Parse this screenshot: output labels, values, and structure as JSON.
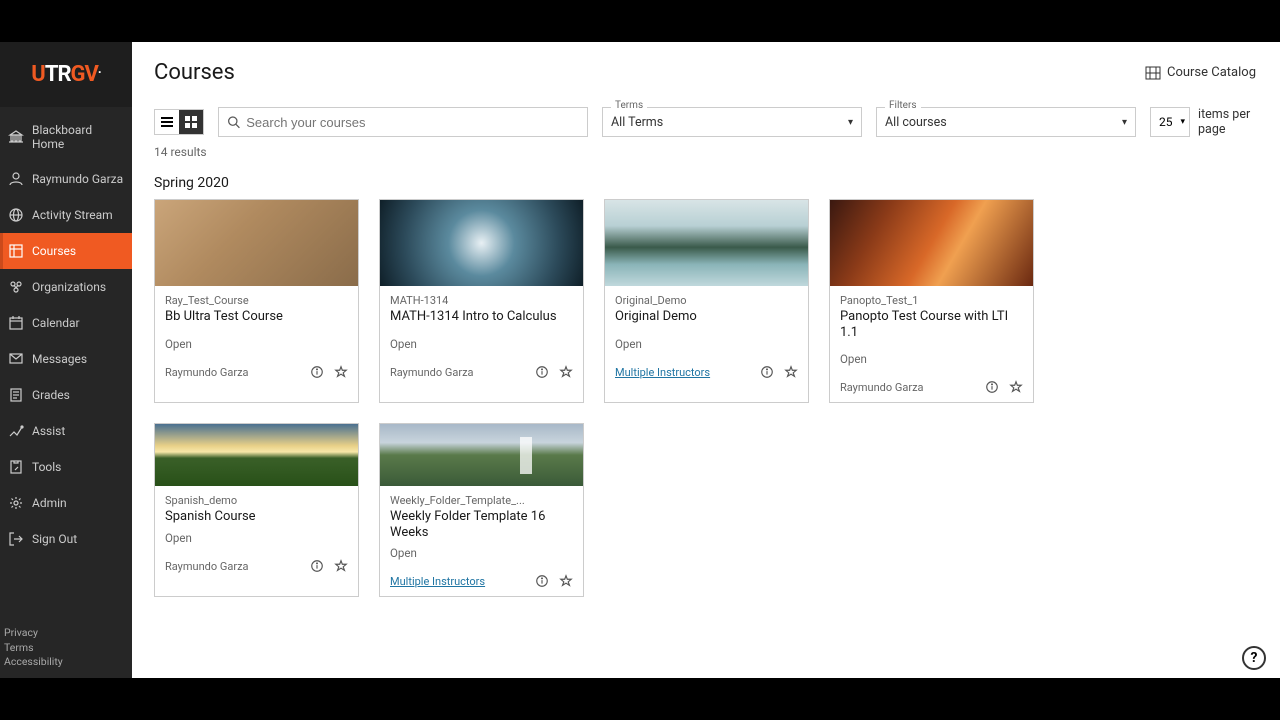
{
  "logo": {
    "text": "UTRGV"
  },
  "sidebar": {
    "items": [
      {
        "label": "Blackboard Home",
        "icon": "institution-icon"
      },
      {
        "label": "Raymundo Garza",
        "icon": "person-icon"
      },
      {
        "label": "Activity Stream",
        "icon": "globe-icon"
      },
      {
        "label": "Courses",
        "icon": "course-icon",
        "active": true
      },
      {
        "label": "Organizations",
        "icon": "organizations-icon"
      },
      {
        "label": "Calendar",
        "icon": "calendar-icon"
      },
      {
        "label": "Messages",
        "icon": "messages-icon"
      },
      {
        "label": "Grades",
        "icon": "grades-icon"
      },
      {
        "label": "Assist",
        "icon": "assist-icon"
      },
      {
        "label": "Tools",
        "icon": "tools-icon"
      },
      {
        "label": "Admin",
        "icon": "admin-icon"
      },
      {
        "label": "Sign Out",
        "icon": "signout-icon"
      }
    ],
    "footer": [
      "Privacy",
      "Terms",
      "Accessibility"
    ]
  },
  "header": {
    "title": "Courses",
    "catalog_link": "Course Catalog"
  },
  "toolbar": {
    "search_placeholder": "Search your courses",
    "terms_label": "Terms",
    "terms_value": "All Terms",
    "filters_label": "Filters",
    "filters_value": "All courses",
    "perpage_value": "25",
    "perpage_suffix": "items per page"
  },
  "results_text": "14 results",
  "term_heading": "Spring 2020",
  "courses": [
    {
      "code": "Ray_Test_Course",
      "title": "Bb Ultra Test Course",
      "status": "Open",
      "instructor": "Raymundo Garza",
      "instructor_link": false,
      "img": "img-building"
    },
    {
      "code": "MATH-1314",
      "title": "MATH-1314 Intro to Calculus",
      "status": "Open",
      "instructor": "Raymundo Garza",
      "instructor_link": false,
      "img": "img-trees"
    },
    {
      "code": "Original_Demo",
      "title": "Original Demo",
      "status": "Open",
      "instructor": "Multiple Instructors",
      "instructor_link": true,
      "img": "img-lake"
    },
    {
      "code": "Panopto_Test_1",
      "title": "Panopto Test Course with LTI 1.1",
      "status": "Open",
      "instructor": "Raymundo Garza",
      "instructor_link": false,
      "img": "img-canyon"
    },
    {
      "code": "Spanish_demo",
      "title": "Spanish Course",
      "status": "Open",
      "instructor": "Raymundo Garza",
      "instructor_link": false,
      "img": "img-field",
      "compact": true
    },
    {
      "code": "Weekly_Folder_Template_...",
      "title": "Weekly Folder Template 16 Weeks",
      "status": "Open",
      "instructor": "Multiple Instructors",
      "instructor_link": true,
      "img": "img-waterfall",
      "compact": true
    }
  ]
}
